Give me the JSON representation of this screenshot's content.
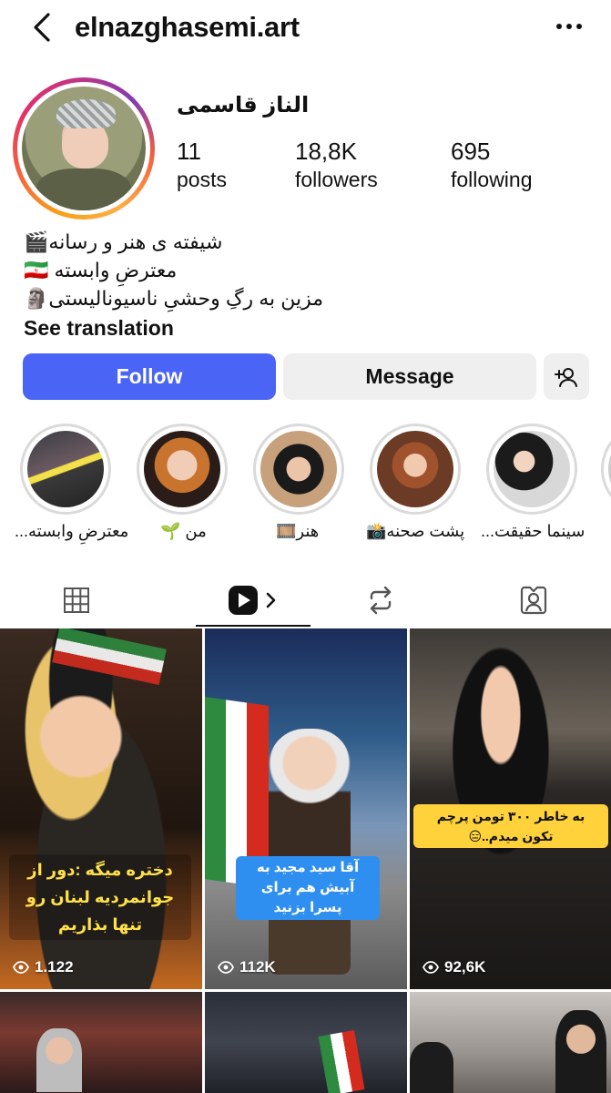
{
  "header": {
    "username": "elnazghasemi.art",
    "back_icon": "chevron-left-icon",
    "more_icon": "ellipsis-icon"
  },
  "profile": {
    "display_name": "الناز قاسمی",
    "stats": [
      {
        "value": "11",
        "label": "posts"
      },
      {
        "value": "18,8K",
        "label": "followers"
      },
      {
        "value": "695",
        "label": "following"
      }
    ],
    "bio": [
      "شیفته ی هنر و رسانه🎬",
      "معترضِ وابسته 🇮🇷",
      "مزین به رگِ وحشیِ ناسیونالیستی🗿"
    ],
    "see_translation": "See translation"
  },
  "actions": {
    "follow": "Follow",
    "message": "Message",
    "add_user_icon": "add-person-icon"
  },
  "highlights": [
    {
      "label": "معترضِ وابسته..."
    },
    {
      "label": "من 🌱"
    },
    {
      "label": "هنر🎞️"
    },
    {
      "label": "پشت صحنه📸"
    },
    {
      "label": "سینما حقیقت..."
    }
  ],
  "tabs": [
    {
      "name": "grid-icon"
    },
    {
      "name": "reels-icon"
    },
    {
      "name": "repost-icon"
    },
    {
      "name": "tagged-icon"
    }
  ],
  "posts": [
    {
      "caption": "دختره میگه :دور از جوانمردیه لبنان رو تنها بذاریم",
      "views": "1.122"
    },
    {
      "caption": "آقا سید مجید به آبیش هم برای پسرا بزنید",
      "views": "112K"
    },
    {
      "caption": "به خاطر ۳۰۰ تومن پرچم تکون میدم..😑",
      "views": "92,6K"
    }
  ],
  "colors": {
    "follow_button": "#4a64f5",
    "secondary_button": "#efefef"
  }
}
